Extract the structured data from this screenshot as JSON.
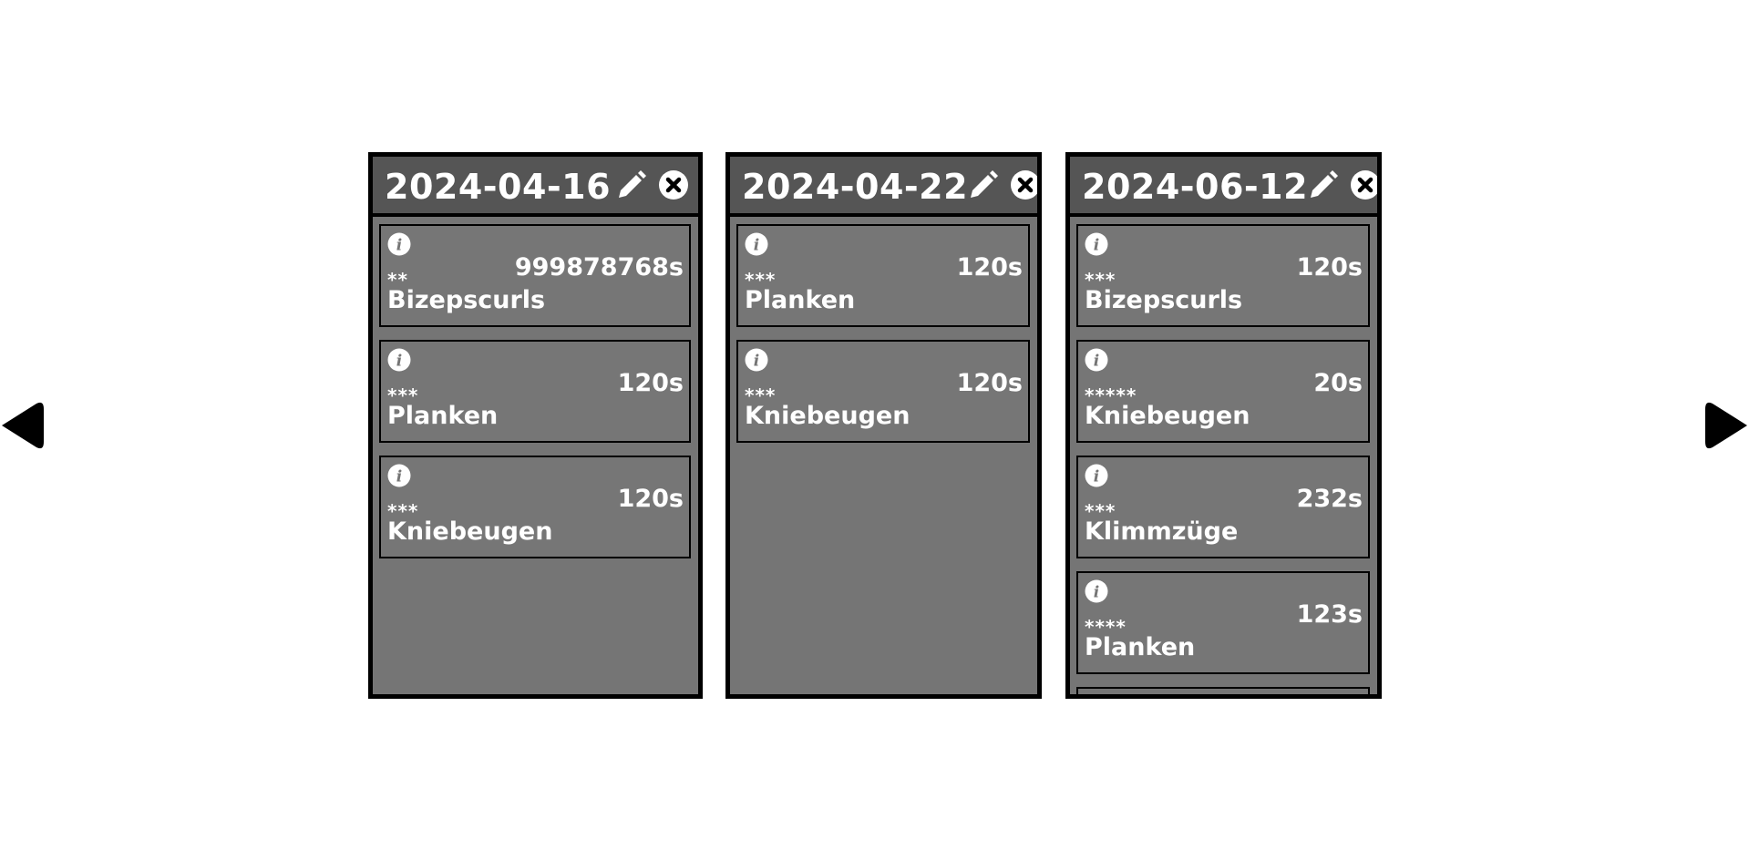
{
  "navigation": {
    "prev_icon": "triangle-left-icon",
    "next_icon": "triangle-right-icon"
  },
  "colors": {
    "background": "#ffffff",
    "column_body": "#757575",
    "column_header": "#555555",
    "border": "#000000",
    "text": "#ffffff"
  },
  "columns": [
    {
      "date": "2024-04-16",
      "edit_icon": "pencil-icon",
      "delete_icon": "close-circle-icon",
      "entries": [
        {
          "rating": "**",
          "name": "Bizepscurls",
          "duration": "999878768s",
          "info_icon": "info-icon"
        },
        {
          "rating": "***",
          "name": "Planken",
          "duration": "120s",
          "info_icon": "info-icon"
        },
        {
          "rating": "***",
          "name": "Kniebeugen",
          "duration": "120s",
          "info_icon": "info-icon"
        }
      ]
    },
    {
      "date": "2024-04-22",
      "edit_icon": "pencil-icon",
      "delete_icon": "close-circle-icon",
      "entries": [
        {
          "rating": "***",
          "name": "Planken",
          "duration": "120s",
          "info_icon": "info-icon"
        },
        {
          "rating": "***",
          "name": "Kniebeugen",
          "duration": "120s",
          "info_icon": "info-icon"
        }
      ]
    },
    {
      "date": "2024-06-12",
      "edit_icon": "pencil-icon",
      "delete_icon": "close-circle-icon",
      "entries": [
        {
          "rating": "***",
          "name": "Bizepscurls",
          "duration": "120s",
          "info_icon": "info-icon"
        },
        {
          "rating": "*****",
          "name": "Kniebeugen",
          "duration": "20s",
          "info_icon": "info-icon"
        },
        {
          "rating": "***",
          "name": "Klimmzüge",
          "duration": "232s",
          "info_icon": "info-icon"
        },
        {
          "rating": "****",
          "name": "Planken",
          "duration": "123s",
          "info_icon": "info-icon"
        },
        {
          "rating": "",
          "name": "",
          "duration": "",
          "info_icon": "info-icon"
        }
      ]
    }
  ]
}
